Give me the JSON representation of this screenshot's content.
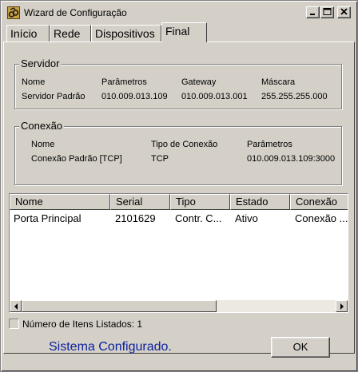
{
  "window": {
    "title": "Wizard de Configuração"
  },
  "tabs": [
    {
      "label": "Início"
    },
    {
      "label": "Rede"
    },
    {
      "label": "Dispositivos"
    },
    {
      "label": "Final"
    }
  ],
  "servidor": {
    "title": "Servidor",
    "headers": [
      "Nome",
      "Parâmetros",
      "Gateway",
      "Máscara"
    ],
    "values": [
      "Servidor Padrão",
      "010.009.013.109",
      "010.009.013.001",
      "255.255.255.000"
    ]
  },
  "conexao": {
    "title": "Conexão",
    "headers": [
      "Nome",
      "Tipo de Conexão",
      "Parâmetros"
    ],
    "values": [
      "Conexão Padrão [TCP]",
      "TCP",
      "010.009.013.109:3000"
    ]
  },
  "list": {
    "columns": [
      "Nome",
      "Serial",
      "Tipo",
      "Estado",
      "Conexão"
    ],
    "rows": [
      [
        "Porta Principal",
        "2101629",
        "Contr. C...",
        "Ativo",
        "Conexão ..."
      ]
    ]
  },
  "status": {
    "text": "Número de Itens Listados: 1"
  },
  "footer": {
    "message": "Sistema Configurado.",
    "ok_label": "OK",
    "message_color": "#0a1f9c"
  }
}
